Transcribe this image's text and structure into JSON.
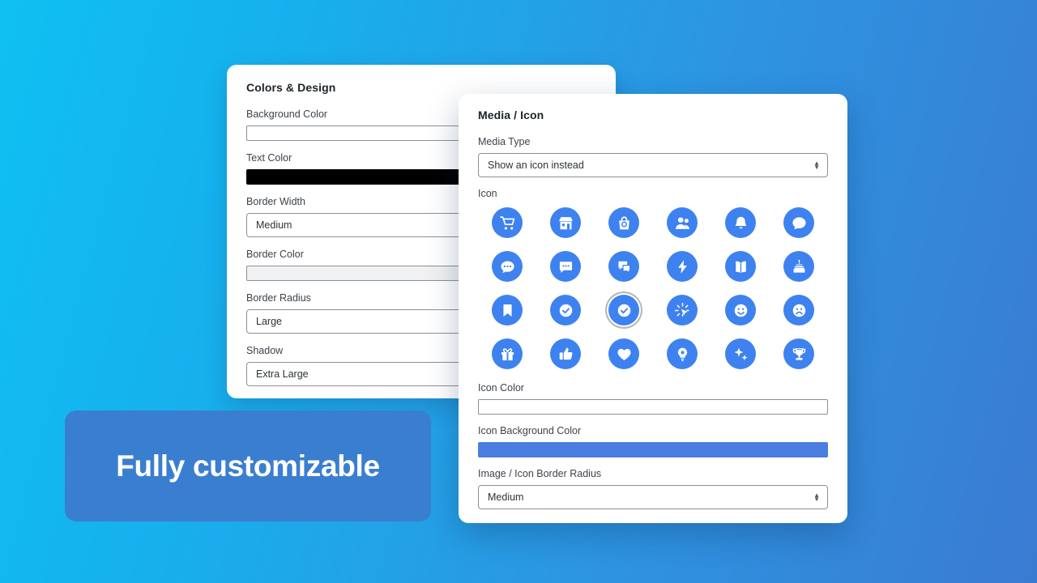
{
  "background": {
    "from": "#0FC0F3",
    "to": "#3A7BD2"
  },
  "accent": {
    "icon_blue": "#3E82F0",
    "badge_blue": "#3A7ED0"
  },
  "left_panel": {
    "title": "Colors & Design",
    "fields": [
      {
        "label": "Background Color",
        "type": "color",
        "value": "#FFFFFF"
      },
      {
        "label": "Text Color",
        "type": "color",
        "value": "#000000"
      },
      {
        "label": "Border Width",
        "type": "select",
        "value": "Medium"
      },
      {
        "label": "Border Color",
        "type": "color",
        "value": "#F0F1F2"
      },
      {
        "label": "Border Radius",
        "type": "select",
        "value": "Large"
      },
      {
        "label": "Shadow",
        "type": "select",
        "value": "Extra Large"
      }
    ]
  },
  "right_panel": {
    "title": "Media / Icon",
    "media_type": {
      "label": "Media Type",
      "value": "Show an icon instead"
    },
    "icon": {
      "label": "Icon",
      "selected_index": 14,
      "items": [
        "shopping-cart-icon",
        "store-icon",
        "shopping-bag-icon",
        "users-icon",
        "bell-icon",
        "chat-bubble-icon",
        "chat-dots-icon",
        "comment-box-icon",
        "chats-icon",
        "lightning-bolt-icon",
        "open-book-icon",
        "cake-icon",
        "bookmark-icon",
        "check-badge-icon",
        "check-circle-icon",
        "cursor-click-icon",
        "smiley-happy-icon",
        "smiley-sad-icon",
        "gift-icon",
        "thumbs-up-icon",
        "heart-icon",
        "lightbulb-icon",
        "sparkles-icon",
        "trophy-icon"
      ]
    },
    "icon_color": {
      "label": "Icon Color",
      "value": "#FFFFFF"
    },
    "icon_background_color": {
      "label": "Icon Background Color",
      "value": "#4A7EE0"
    },
    "border_radius": {
      "label": "Image / Icon Border Radius",
      "value": "Medium"
    }
  },
  "badge": {
    "text": "Fully customizable"
  }
}
